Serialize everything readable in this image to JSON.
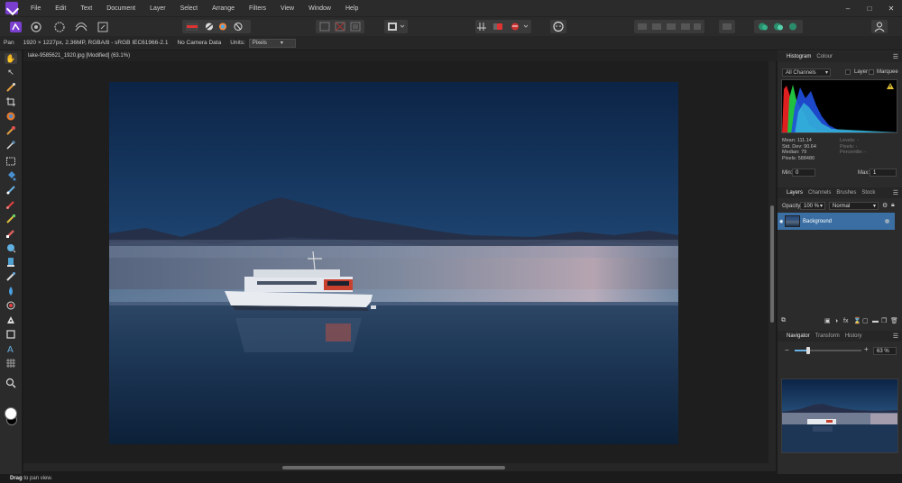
{
  "menu": {
    "items": [
      "File",
      "Edit",
      "Text",
      "Document",
      "Layer",
      "Select",
      "Arrange",
      "Filters",
      "View",
      "Window",
      "Help"
    ],
    "window_controls": [
      "–",
      "□",
      "✕"
    ]
  },
  "context_bar": {
    "tool": "Pan",
    "image_info": "1920 × 1227px, 2.36MP, RGBA/8 - sRGB IEC61966-2.1",
    "camera": "No Camera Data",
    "units_label": "Units:",
    "units_value": "Pixels"
  },
  "document": {
    "tab_title": "lake-9585621_1920.jpg [Modified] (63.1%)"
  },
  "status": {
    "action": "Drag",
    "hint": " to pan view."
  },
  "histogram_panel": {
    "tabs": [
      "Histogram",
      "Colour"
    ],
    "channel": "All Channels",
    "layer_label": "Layer",
    "marquee_label": "Marquee",
    "stats_left": [
      "Mean: 111.14",
      "Std. Dev: 90.64",
      "Median: 79",
      "Pixels: 588480"
    ],
    "stats_right": [
      "Levels: -",
      "Pixels: -",
      "Percentile: -"
    ],
    "min_label": "Min:",
    "min_value": "0",
    "max_label": "Max:",
    "max_value": "1",
    "warning_icon": "warning-icon"
  },
  "layers_panel": {
    "tabs": [
      "Layers",
      "Channels",
      "Brushes",
      "Stock"
    ],
    "opacity_label": "Opacity:",
    "opacity_value": "100 %",
    "blend_mode": "Normal",
    "layers": [
      {
        "name": "Background"
      }
    ]
  },
  "navigator_panel": {
    "tabs": [
      "Navigator",
      "Transform",
      "History"
    ],
    "minus": "−",
    "plus": "+",
    "zoom_value": "63 %",
    "zoom_fraction": 0.2
  },
  "colors": {
    "accent": "#7b3fd0",
    "layer_selected": "#3b6fa3",
    "panel_bg": "#2b2b2b"
  }
}
